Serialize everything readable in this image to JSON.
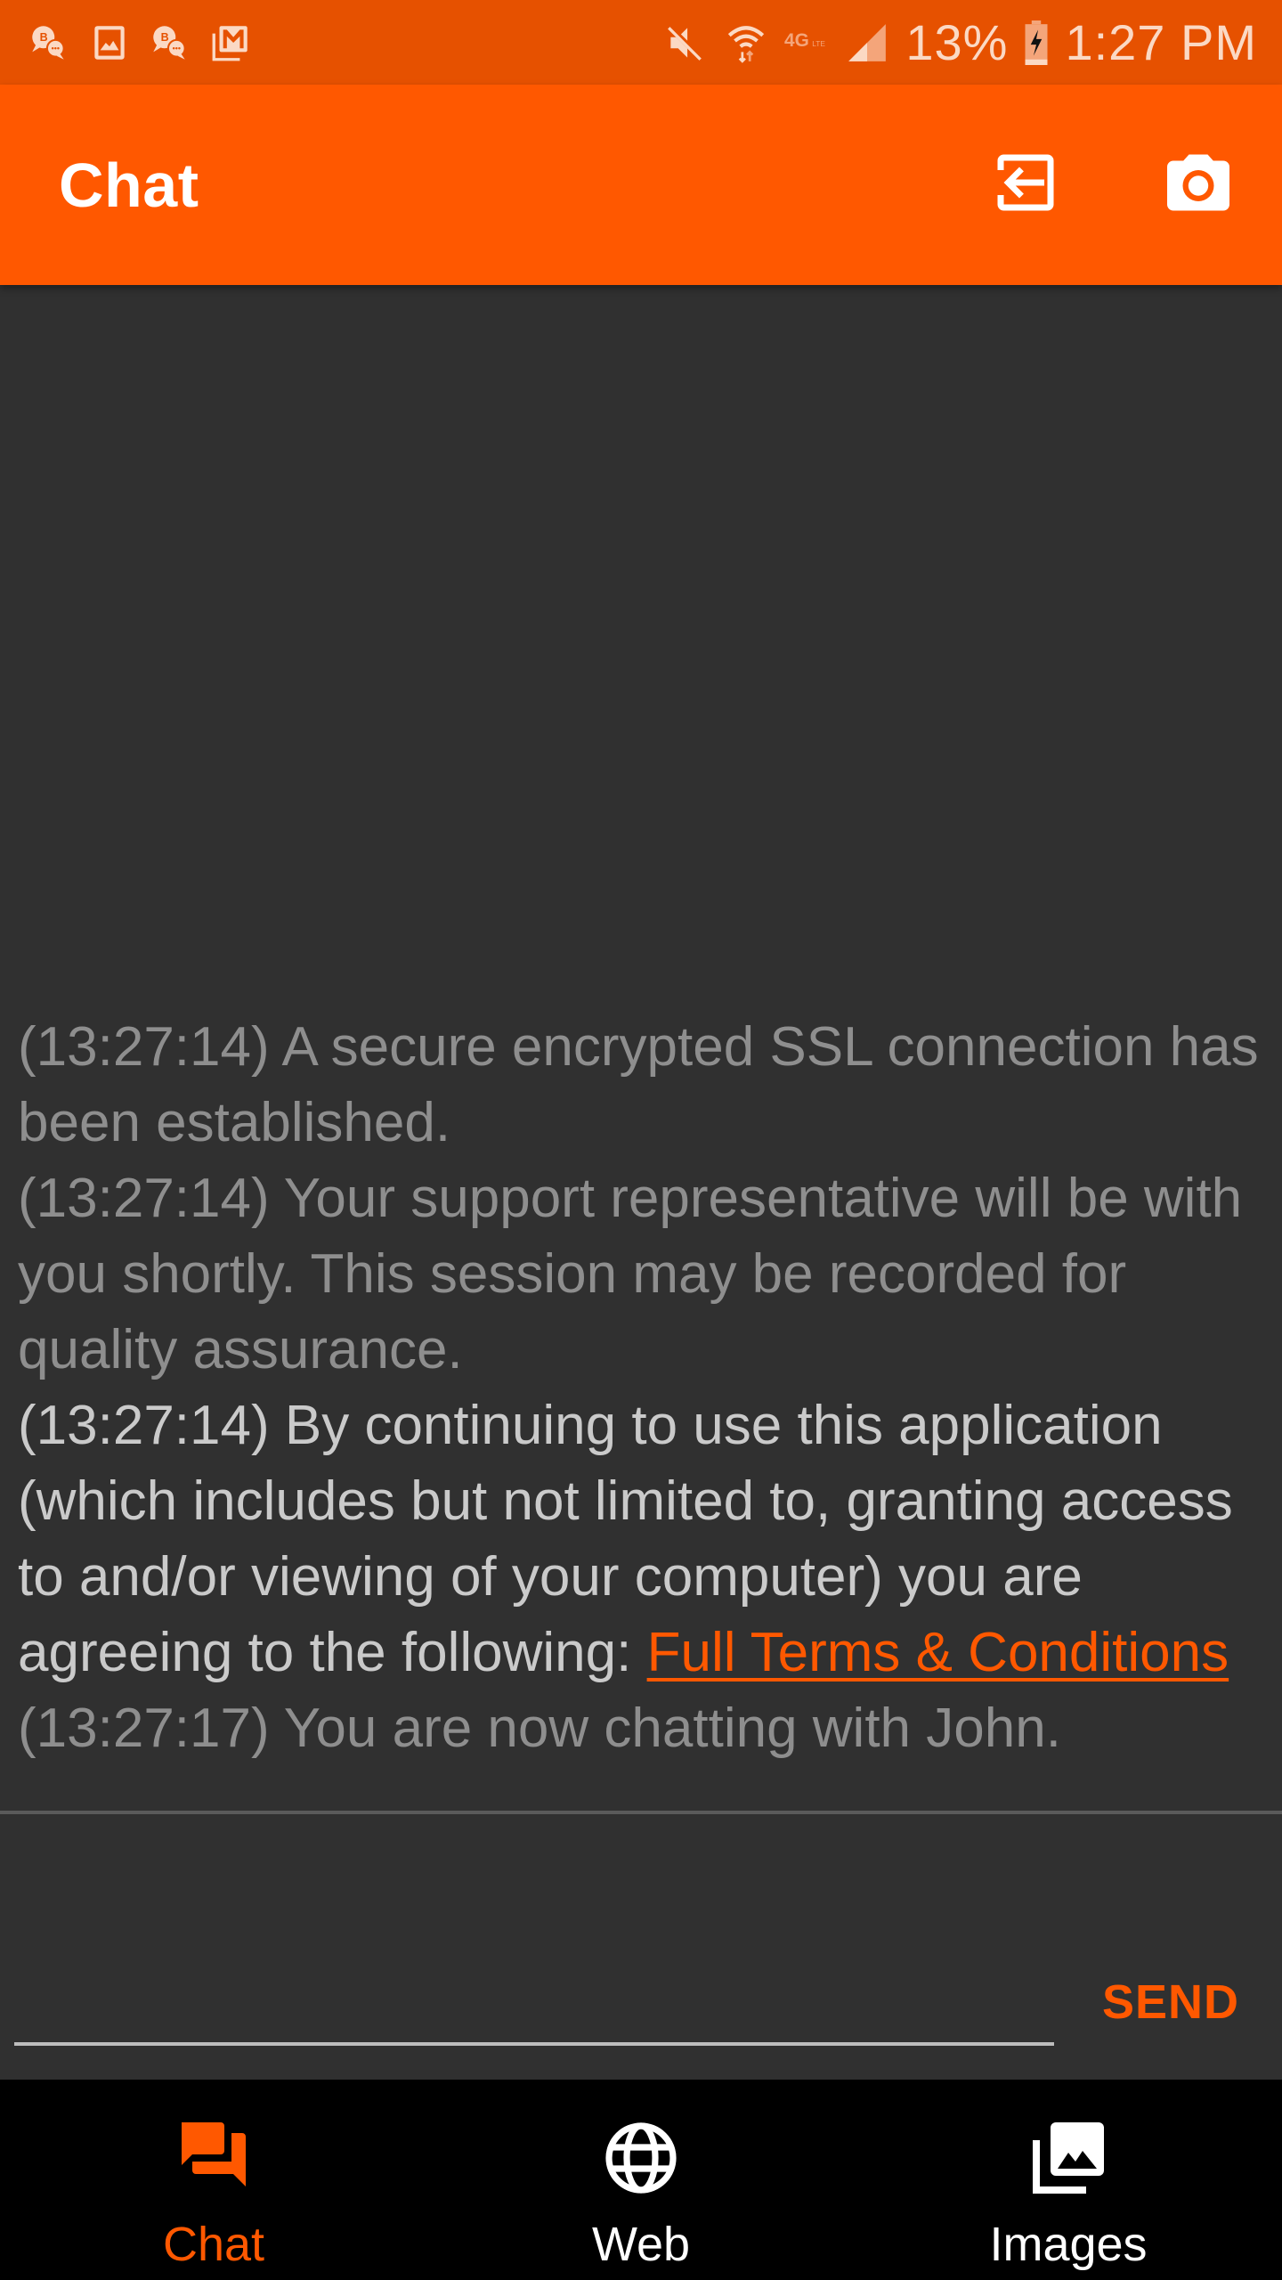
{
  "status_bar": {
    "left_icons": [
      "bbm-chat-icon",
      "gallery-icon",
      "bbm-chat-icon",
      "gmail-icon"
    ],
    "right_icons": [
      "mute-icon",
      "wifi-icon",
      "4g-lte-icon",
      "signal-icon"
    ],
    "battery_percent": "13%",
    "time": "1:27 PM",
    "battery_level": 0.13,
    "charging": true
  },
  "app_bar": {
    "title": "Chat",
    "actions": [
      {
        "name": "exit-session",
        "icon": "exit-icon"
      },
      {
        "name": "screenshot",
        "icon": "camera-icon"
      }
    ]
  },
  "messages": [
    {
      "time": "(13:27:14)",
      "text": "A secure encrypted SSL connection has been established.",
      "style": "system"
    },
    {
      "time": "(13:27:14)",
      "text": "Your support representative will be with you shortly. This session may be recorded for quality assurance.",
      "style": "system"
    },
    {
      "time": "(13:27:14)",
      "text": "By continuing to use this application (which includes but not limited to, granting access to and/or viewing of your computer) you are agreeing to the following:",
      "link_text": "Full Terms & Conditions",
      "style": "notice"
    },
    {
      "time": "(13:27:17)",
      "text": "You are now chatting with John.",
      "style": "system"
    }
  ],
  "composer": {
    "input_value": "",
    "placeholder": "",
    "send_label": "SEND"
  },
  "bottom_nav": {
    "items": [
      {
        "label": "Chat",
        "icon": "chat-icon",
        "active": true
      },
      {
        "label": "Web",
        "icon": "globe-icon",
        "active": false
      },
      {
        "label": "Images",
        "icon": "images-icon",
        "active": false
      }
    ]
  },
  "colors": {
    "status_bar": "#E65100",
    "app_bar": "#FF5800",
    "accent": "#FF5800",
    "background": "#303030",
    "bottom_nav": "#000000",
    "system_text": "#8E8E8E",
    "notice_text": "#CACACA"
  }
}
